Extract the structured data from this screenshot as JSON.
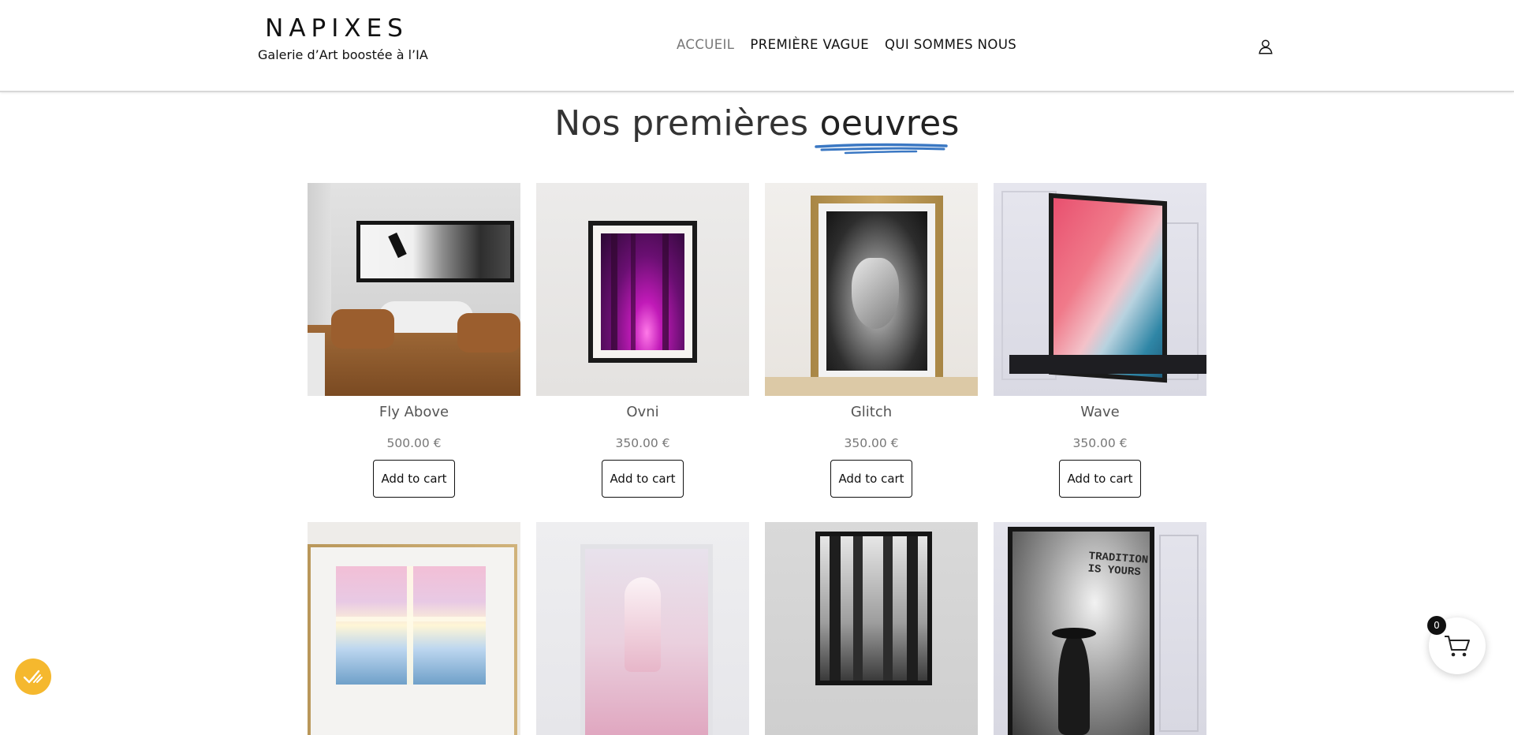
{
  "brand": {
    "name": "NAPIXES",
    "tagline": "Galerie d’Art boostée à l’IA"
  },
  "nav": {
    "items": [
      "ACCUEIL",
      "PREMIÈRE VAGUE",
      "QUI SOMMES NOUS"
    ],
    "active": "ACCUEIL"
  },
  "heading": {
    "prefix": "Nos premières",
    "emphasis": "oeuvres",
    "underline_color": "#3b78c3"
  },
  "products": [
    {
      "name": "Fly Above",
      "price": "500.00 €",
      "button": "Add to cart"
    },
    {
      "name": "Ovni",
      "price": "350.00 €",
      "button": "Add to cart"
    },
    {
      "name": "Glitch",
      "price": "350.00 €",
      "button": "Add to cart"
    },
    {
      "name": "Wave",
      "price": "350.00 €",
      "button": "Add to cart"
    },
    {
      "name": "",
      "price": "",
      "button": ""
    },
    {
      "name": "",
      "price": "",
      "button": ""
    },
    {
      "name": "",
      "price": "",
      "button": ""
    },
    {
      "name": "",
      "price": "",
      "button": "",
      "poster_text": "TRADITION IS YOURS"
    }
  ],
  "cart": {
    "count": "0"
  },
  "colors": {
    "cookie_accent": "#f5b82e",
    "text": "#111111",
    "muted": "#777777"
  },
  "icons": {
    "user": "user-icon",
    "cart": "cart-icon",
    "cookie": "cookie-check-icon"
  }
}
